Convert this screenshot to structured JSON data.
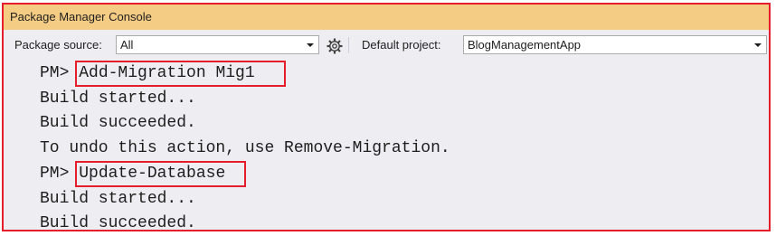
{
  "window": {
    "title": "Package Manager Console"
  },
  "toolbar": {
    "package_source_label": "Package source:",
    "package_source_value": "All",
    "default_project_label": "Default project:",
    "default_project_value": "BlogManagementApp"
  },
  "console": {
    "prompt": "PM>",
    "lines": [
      {
        "prompt": "PM>",
        "text": "Add-Migration Mig1"
      },
      {
        "text": "Build started..."
      },
      {
        "text": "Build succeeded."
      },
      {
        "text": "To undo this action, use Remove-Migration."
      },
      {
        "prompt": "PM>",
        "text": "Update-Database"
      },
      {
        "text": "Build started..."
      },
      {
        "text": "Build succeeded."
      }
    ]
  },
  "colors": {
    "title_bar": "#f5cc84",
    "highlight_border": "#e41e2b",
    "background": "#eeeef2"
  }
}
